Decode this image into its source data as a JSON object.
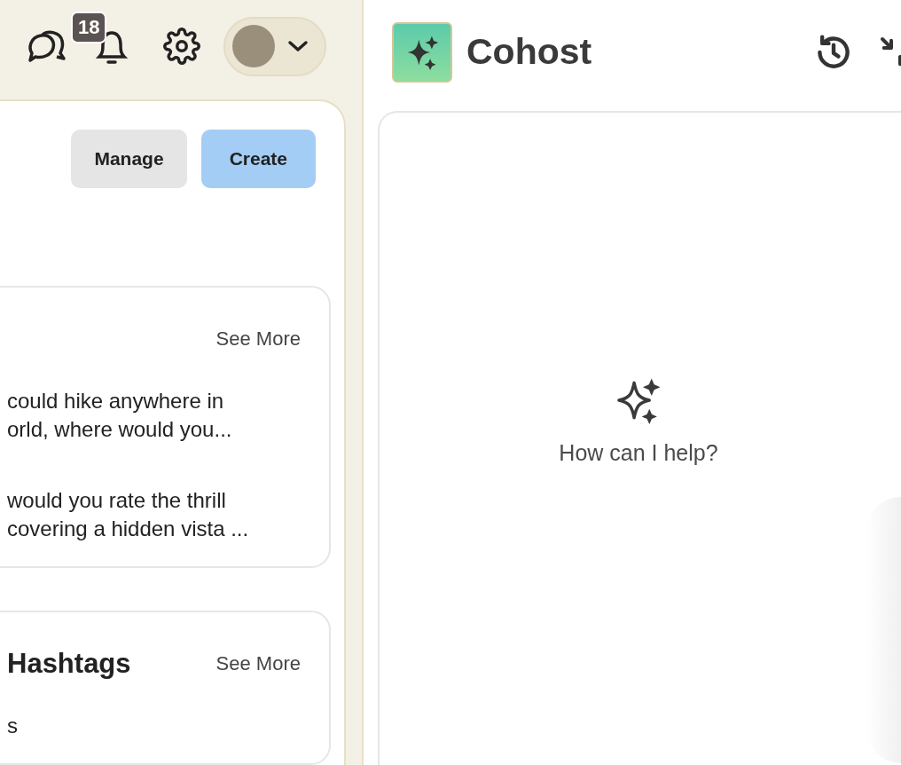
{
  "top_bar": {
    "notification_count": "18"
  },
  "actions": [
    {
      "label": "Manage",
      "kind": "secondary"
    },
    {
      "label": "Create",
      "kind": "primary"
    }
  ],
  "cards": [
    {
      "link": "See More",
      "items": [
        {
          "lines": [
            "could hike anywhere in",
            "orld, where would you..."
          ]
        },
        {
          "lines": [
            "would you rate the thrill",
            "covering a hidden vista ..."
          ]
        }
      ]
    },
    {
      "title": "Hashtags",
      "link": "See More",
      "items": [
        {
          "lines": [
            "s"
          ]
        }
      ]
    }
  ],
  "cohost": {
    "title": "Cohost",
    "prompt": "How can I help?"
  }
}
